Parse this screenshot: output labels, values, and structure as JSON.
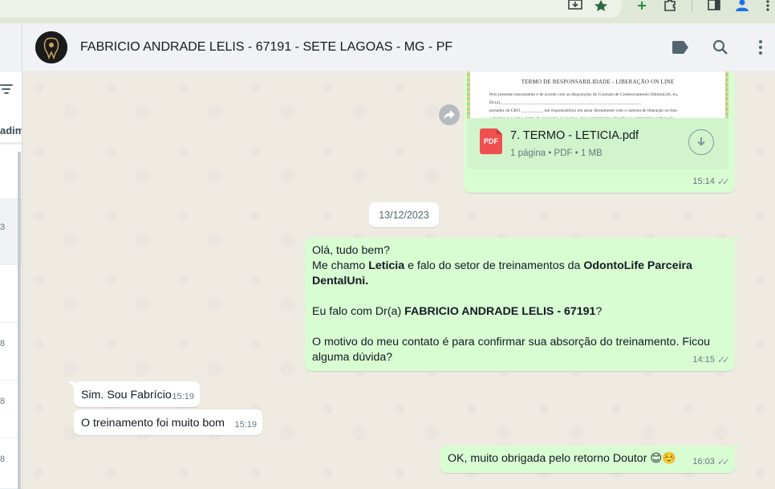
{
  "contact": {
    "name": "FABRICIO ANDRADE LELIS - 67191 - SETE LAGOAS - MG - PF"
  },
  "sidebar": {
    "partial_text": "adim",
    "row_numbers": [
      "3",
      "8",
      "8",
      "8"
    ]
  },
  "document_message": {
    "preview_title": "TERMO DE RESPONSABILIDADE - LIBERAÇÃO ON LINE",
    "preview_lines": [
      "Pelo presente instrumento e de acordo com as disposições do Contrato de Credenciamento  OdontoLife,  eu,",
      "Dr.(a)________________________________________________________________",
      "portador do CRO __________ me responsabilizo em atuar diretamente com o sistema de liberação on-line",
      "e declaro que estou ciente de que todos os exames, atos e tratamentos deverão ser submetidos à liberação"
    ],
    "file_name": "7. TERMO - LETICIA.pdf",
    "file_meta": "1 página • PDF • 1 MB",
    "time": "15:14"
  },
  "date_separator": "13/12/2023",
  "outgoing_message_1": {
    "line1": "Olá, tudo bem?",
    "line2_a": "Me chamo ",
    "line2_b": "Leticia",
    "line2_c": " e falo do setor de treinamentos  da ",
    "line2_d": "OdontoLife Parceira DentalUni.",
    "line3_a": " Eu falo com Dr(a) ",
    "line3_b": "FABRICIO ANDRADE LELIS - 67191",
    "line3_c": "?",
    "line4": "O motivo do meu contato é para confirmar sua absorção do treinamento. Ficou alguma dúvida?",
    "time": "14:15"
  },
  "incoming_messages": [
    {
      "text": "Sim. Sou Fabrício",
      "time": "15:19"
    },
    {
      "text": "O treinamento foi muito bom",
      "time": "15:19"
    }
  ],
  "outgoing_message_2": {
    "text": "OK, muito obrigada pelo retorno Doutor",
    "emoji": "😊☺️",
    "time": "16:03"
  },
  "ticks": "✓✓",
  "icons": {
    "header": [
      "label-icon",
      "search-icon",
      "menu-icon"
    ],
    "browser": [
      "install-icon",
      "star-icon",
      "extension-plus-icon",
      "puzzle-icon",
      "sidepanel-icon",
      "profile-icon",
      "browser-menu-icon"
    ]
  },
  "colors": {
    "outgoing_bubble": "#d9fdd3",
    "incoming_bubble": "#ffffff",
    "background": "#efeae2",
    "header": "#f0f2f5",
    "pdf": "#f04f4f"
  }
}
